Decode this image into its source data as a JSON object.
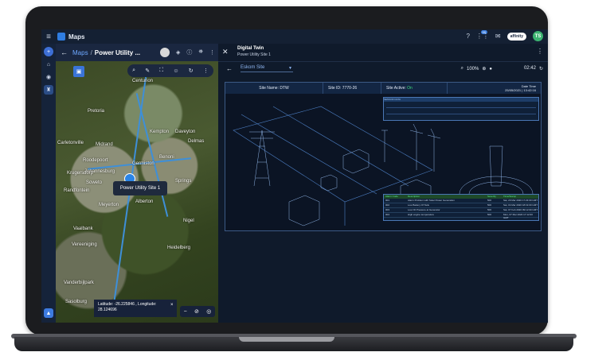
{
  "topbar": {
    "title": "Maps",
    "menu_icon": "≡",
    "help_icon": "?",
    "apps_icon": "⋮⋮",
    "notifications_badge": "99",
    "brand_label": "affinity",
    "avatar_initials": "TS"
  },
  "map_panel": {
    "crumb_root": "Maps",
    "crumb_sep": "/",
    "crumb_title": "Power Utility ...",
    "pin_label": "Power Utility Site 1",
    "coords_text": "Latitude: -26.225846 , Longitude: 28.124696",
    "towns": [
      "Centurion",
      "Pretoria",
      "Kempton",
      "Midrand",
      "Roodepoort",
      "Johannesburg",
      "Germiston",
      "Benoni",
      "Springs",
      "Soweto",
      "Alberton",
      "Meyerton",
      "Vereeniging",
      "Heidelberg",
      "Vanderbijlpark",
      "Sasolburg",
      "Carletonville",
      "Randfontein",
      "Krugersdorp",
      "Nigel",
      "Delmas",
      "Daveyton",
      "Vaalbank"
    ]
  },
  "twin": {
    "title": "Digital Twin",
    "subtitle": "Power Utility Site 1",
    "site_select": "Eskom Site",
    "zoom": "100%",
    "time": "02:42",
    "site_name": "Site Name: DTW",
    "site_id": "Site ID: 7770-26",
    "site_active_label": "Site Active:",
    "site_active_value": "On",
    "date_label": "Date Time",
    "date_value": "25/05/2021 | 13:42:16",
    "sensor_title": "SENSOR DATA",
    "sensor_headers": [
      "Sensor Name",
      "Status",
      "Priority",
      "Description"
    ],
    "alarm_headers": [
      "Alarm Code",
      "Description",
      "Severity",
      "Time/Stamp"
    ],
    "alarms": [
      [
        "001",
        "Alarm Problem with Solar Power Generation",
        "500",
        "Sat, 29 Mar 2020 17:23:00 GMT"
      ],
      [
        "002",
        "Low Battery Of Tank",
        "500",
        "Sat, 04 Mar 2020 18:19:00 GMT"
      ],
      [
        "003",
        "Low Oil Pressure at Generator",
        "500",
        "Sat, 07 Feb 2020 09:12:00 GMT"
      ],
      [
        "004",
        "High engine temperature",
        "500",
        "Mon, 07 Mar 2020 17:12:00 GMT"
      ]
    ]
  },
  "colors": {
    "accent": "#2f7de1",
    "active": "#3ee07c",
    "frame": "#1b1c1f"
  }
}
